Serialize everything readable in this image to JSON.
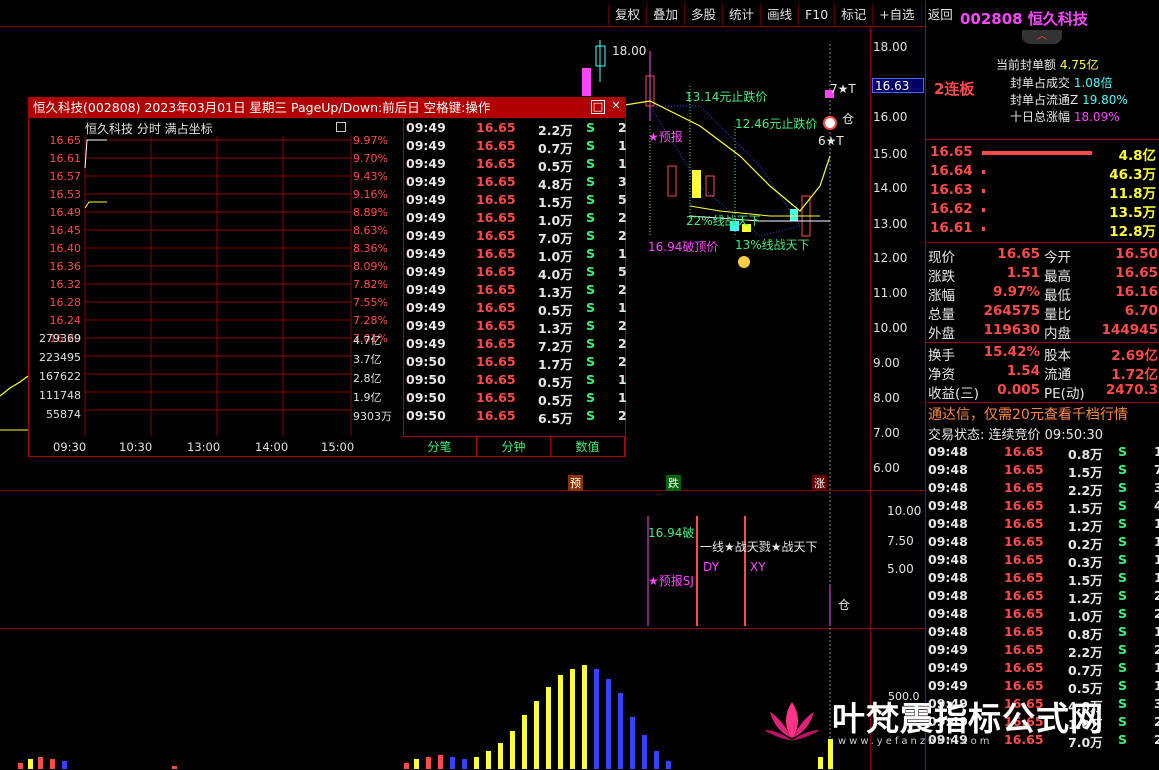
{
  "toolbar": [
    "复权",
    "叠加",
    "多股",
    "统计",
    "画线",
    "F10",
    "标记",
    "+自选",
    "返回"
  ],
  "main_axis": {
    "price_ticks": [
      "18.00",
      "16.00",
      "15.00",
      "14.00",
      "13.00",
      "12.00",
      "11.00",
      "10.00",
      "9.00",
      "8.00",
      "7.00",
      "6.00"
    ],
    "current_price_label": "16.63",
    "indicator_ticks": [
      "10.00",
      "7.50",
      "5.00"
    ],
    "volume_tick": "500.0"
  },
  "chart_annotations": {
    "high_label": "18.00",
    "stop_fall_1": "13.14元止跌价",
    "stop_fall_2": "12.46元止跌价",
    "yubao": "★预报",
    "line22": "22%线战天下",
    "line13": "13%线战天下",
    "break_label": "16.94破顶价",
    "seven_t": "7★T",
    "six_t": "6★T",
    "position_label": "仓",
    "markers": {
      "yu": "预",
      "die": "跌",
      "zhang": "涨"
    },
    "ind_break": "16.94破",
    "ind_line": "一线★战天戮★战天下",
    "ind_dy": "DY",
    "ind_xy": "XY",
    "ind_yubao": "★预报SJ",
    "ind_cang": "仓"
  },
  "popup": {
    "title": "恒久科技(002808) 2023年03月01日 星期三 PageUp/Down:前后日 空格键:操作",
    "mini_header": "恒久科技   分时 满占坐标",
    "price_labels": [
      "16.65",
      "16.61",
      "16.57",
      "16.53",
      "16.49",
      "16.45",
      "16.40",
      "16.36",
      "16.32",
      "16.28",
      "16.24",
      "16.20"
    ],
    "pct_labels": [
      "9.97%",
      "9.70%",
      "9.43%",
      "9.16%",
      "8.89%",
      "8.63%",
      "8.36%",
      "8.09%",
      "7.82%",
      "7.55%",
      "7.28%",
      "7.01%"
    ],
    "vol_labels_left": [
      "279369",
      "223495",
      "167622",
      "111748",
      "55874"
    ],
    "vol_labels_right": [
      "4.7亿",
      "3.7亿",
      "2.8亿",
      "1.9亿",
      "9303万"
    ],
    "time_labels": [
      "09:30",
      "10:30",
      "13:00",
      "14:00",
      "15:00"
    ],
    "ticks": [
      {
        "t": "09:49",
        "p": "16.65",
        "v": "2.2万",
        "s": "S",
        "n": "2"
      },
      {
        "t": "09:49",
        "p": "16.65",
        "v": "0.7万",
        "s": "S",
        "n": "1"
      },
      {
        "t": "09:49",
        "p": "16.65",
        "v": "0.5万",
        "s": "S",
        "n": "1"
      },
      {
        "t": "09:49",
        "p": "16.65",
        "v": "4.8万",
        "s": "S",
        "n": "3"
      },
      {
        "t": "09:49",
        "p": "16.65",
        "v": "1.5万",
        "s": "S",
        "n": "5"
      },
      {
        "t": "09:49",
        "p": "16.65",
        "v": "1.0万",
        "s": "S",
        "n": "2"
      },
      {
        "t": "09:49",
        "p": "16.65",
        "v": "7.0万",
        "s": "S",
        "n": "2"
      },
      {
        "t": "09:49",
        "p": "16.65",
        "v": "1.0万",
        "s": "S",
        "n": "1"
      },
      {
        "t": "09:49",
        "p": "16.65",
        "v": "4.0万",
        "s": "S",
        "n": "5"
      },
      {
        "t": "09:49",
        "p": "16.65",
        "v": "1.3万",
        "s": "S",
        "n": "2"
      },
      {
        "t": "09:49",
        "p": "16.65",
        "v": "0.5万",
        "s": "S",
        "n": "1"
      },
      {
        "t": "09:49",
        "p": "16.65",
        "v": "1.3万",
        "s": "S",
        "n": "2"
      },
      {
        "t": "09:49",
        "p": "16.65",
        "v": "7.2万",
        "s": "S",
        "n": "2"
      },
      {
        "t": "09:50",
        "p": "16.65",
        "v": "1.7万",
        "s": "S",
        "n": "2"
      },
      {
        "t": "09:50",
        "p": "16.65",
        "v": "0.5万",
        "s": "S",
        "n": "1"
      },
      {
        "t": "09:50",
        "p": "16.65",
        "v": "0.5万",
        "s": "S",
        "n": "1"
      },
      {
        "t": "09:50",
        "p": "16.65",
        "v": "6.5万",
        "s": "S",
        "n": "2"
      }
    ],
    "tabs": [
      "分笔",
      "分钟",
      "数值"
    ]
  },
  "right_panel": {
    "code": "002808",
    "name": "恒久科技",
    "consec": "2连板",
    "seal_amount_label": "当前封单额",
    "seal_amount": "4.75亿",
    "seal_vol_label": "封单占成交",
    "seal_vol": "1.08倍",
    "seal_float_label": "封单占流通Z",
    "seal_float": "19.80%",
    "ten_day_label": "十日总涨幅",
    "ten_day": "18.09%",
    "bids": [
      {
        "p": "16.65",
        "v": "4.8亿"
      },
      {
        "p": "16.64",
        "v": "46.3万"
      },
      {
        "p": "16.63",
        "v": "11.8万"
      },
      {
        "p": "16.62",
        "v": "13.5万"
      },
      {
        "p": "16.61",
        "v": "12.8万"
      }
    ],
    "stats": [
      {
        "l1": "现价",
        "v1": "16.65",
        "l2": "今开",
        "v2": "16.50"
      },
      {
        "l1": "涨跌",
        "v1": "1.51",
        "l2": "最高",
        "v2": "16.65"
      },
      {
        "l1": "涨幅",
        "v1": "9.97%",
        "l2": "最低",
        "v2": "16.16"
      },
      {
        "l1": "总量",
        "v1": "264575",
        "l2": "量比",
        "v2": "6.70"
      },
      {
        "l1": "外盘",
        "v1": "119630",
        "l2": "内盘",
        "v2": "144945"
      }
    ],
    "stats2": [
      {
        "l1": "换手",
        "v1": "15.42%",
        "l2": "股本",
        "v2": "2.69亿"
      },
      {
        "l1": "净资",
        "v1": "1.54",
        "l2": "流通",
        "v2": "1.72亿"
      },
      {
        "l1": "收益(三)",
        "v1": "0.005",
        "l2": "PE(动)",
        "v2": "2470.3"
      }
    ],
    "ad": "通达信，仅需20元查看千档行情",
    "trade_state_label": "交易状态: 连续竞价",
    "trade_state_time": "09:50:30",
    "trades": [
      {
        "t": "09:48",
        "p": "16.65",
        "v": "0.8万",
        "s": "S",
        "n": "1"
      },
      {
        "t": "09:48",
        "p": "16.65",
        "v": "1.5万",
        "s": "S",
        "n": "7"
      },
      {
        "t": "09:48",
        "p": "16.65",
        "v": "2.2万",
        "s": "S",
        "n": "3"
      },
      {
        "t": "09:48",
        "p": "16.65",
        "v": "1.5万",
        "s": "S",
        "n": "4"
      },
      {
        "t": "09:48",
        "p": "16.65",
        "v": "1.2万",
        "s": "S",
        "n": "1"
      },
      {
        "t": "09:48",
        "p": "16.65",
        "v": "0.2万",
        "s": "S",
        "n": "1"
      },
      {
        "t": "09:48",
        "p": "16.65",
        "v": "0.3万",
        "s": "S",
        "n": "1"
      },
      {
        "t": "09:48",
        "p": "16.65",
        "v": "1.5万",
        "s": "S",
        "n": "1"
      },
      {
        "t": "09:48",
        "p": "16.65",
        "v": "1.2万",
        "s": "S",
        "n": "2"
      },
      {
        "t": "09:48",
        "p": "16.65",
        "v": "1.0万",
        "s": "S",
        "n": "2"
      },
      {
        "t": "09:48",
        "p": "16.65",
        "v": "0.8万",
        "s": "S",
        "n": "1"
      },
      {
        "t": "09:49",
        "p": "16.65",
        "v": "2.2万",
        "s": "S",
        "n": "2"
      },
      {
        "t": "09:49",
        "p": "16.65",
        "v": "0.7万",
        "s": "S",
        "n": "1"
      },
      {
        "t": "09:49",
        "p": "16.65",
        "v": "0.5万",
        "s": "S",
        "n": "1"
      },
      {
        "t": "09:49",
        "p": "16.65",
        "v": "4.8万",
        "s": "S",
        "n": "3"
      },
      {
        "t": "09:49",
        "p": "16.65",
        "v": "1.0万",
        "s": "S",
        "n": "2"
      },
      {
        "t": "09:49",
        "p": "16.65",
        "v": "7.0万",
        "s": "S",
        "n": "2"
      }
    ]
  },
  "watermark": {
    "text": "叶梵震指标公式网",
    "url": "www.yefanzhen.com"
  },
  "colors": {
    "up": "#ff4a4a",
    "down": "#3cf07a",
    "grid": "#8a0000",
    "accent": "#ff44ff",
    "yellow": "#ffff33"
  }
}
